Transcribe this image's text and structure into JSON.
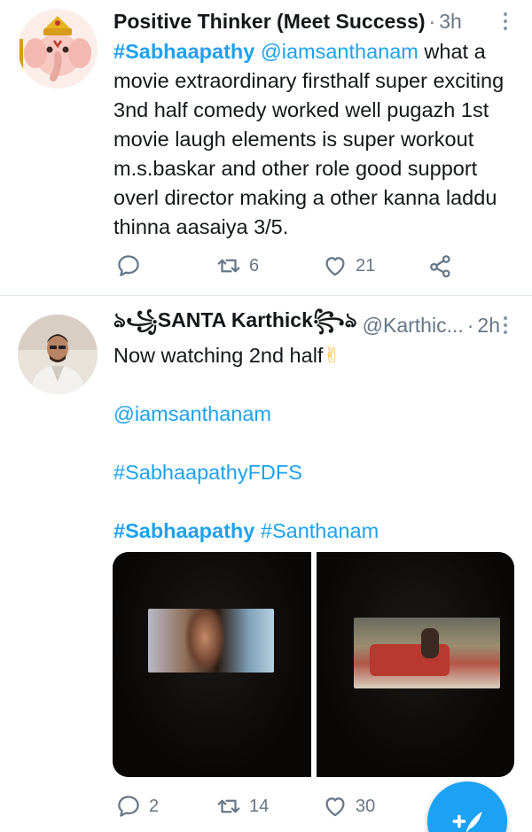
{
  "tweets": [
    {
      "author_name": "Positive Thinker (Meet Success)",
      "dot": "·",
      "time": "3h",
      "body": {
        "tag": "#Sabhaapathy",
        "mention": "@iamsanthanam",
        "text": " what a movie extraordinary firsthalf super exciting 3nd half comedy worked well pugazh 1st movie laugh elements is super workout m.s.baskar and other role good support overl director making a other kanna laddu thinna aasaiya 3/5."
      },
      "actions": {
        "replies": "",
        "retweets": "6",
        "likes": "21"
      }
    },
    {
      "author_name": "ঌ꧁SANTA Karthick꧂ঌ",
      "handle": "@Karthic...",
      "dot": "·",
      "time": "2h",
      "body": {
        "line1": "Now watching 2nd half",
        "emoji": "✌",
        "mention": "@iamsanthanam",
        "hashtag1": "#SabhaapathyFDFS",
        "tag_bold": "#Sabhaapathy",
        "hashtag2": "#Santhanam"
      },
      "actions": {
        "replies": "2",
        "retweets": "14",
        "likes": "30"
      }
    }
  ],
  "colors": {
    "accent": "#1da1f2",
    "muted": "#657786",
    "text": "#14171a"
  },
  "icons": [
    "more-vertical-icon",
    "reply-icon",
    "retweet-icon",
    "like-icon",
    "share-icon",
    "compose-icon"
  ]
}
